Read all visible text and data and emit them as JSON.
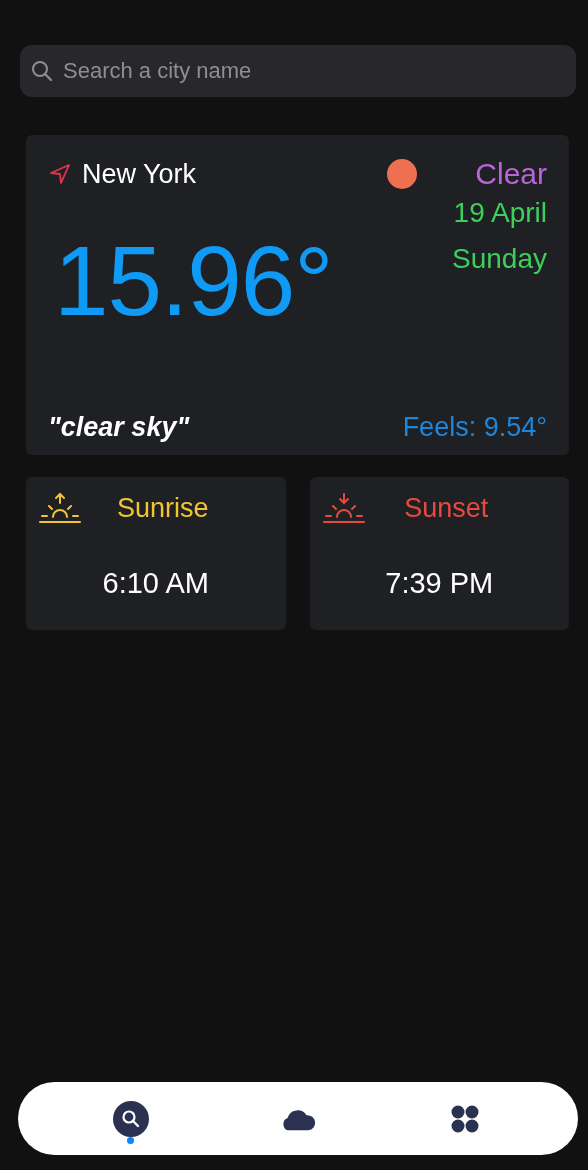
{
  "search": {
    "placeholder": "Search a city name"
  },
  "current": {
    "city": "New York",
    "condition": "Clear",
    "date": "19 April",
    "weekday": "Sunday",
    "temperature": "15.96°",
    "description": "\"clear sky\"",
    "feels": "Feels: 9.54°"
  },
  "sun_cards": [
    {
      "kind": "sunrise",
      "label": "Sunrise",
      "time": "6:10 AM",
      "color": "#f2c430"
    },
    {
      "kind": "sunset",
      "label": "Sunset",
      "time": "7:39 PM",
      "color": "#e8493f"
    }
  ],
  "tab_bar": [
    {
      "kind": "search",
      "selected": true
    },
    {
      "kind": "weather",
      "selected": false
    },
    {
      "kind": "menu",
      "selected": false
    }
  ]
}
